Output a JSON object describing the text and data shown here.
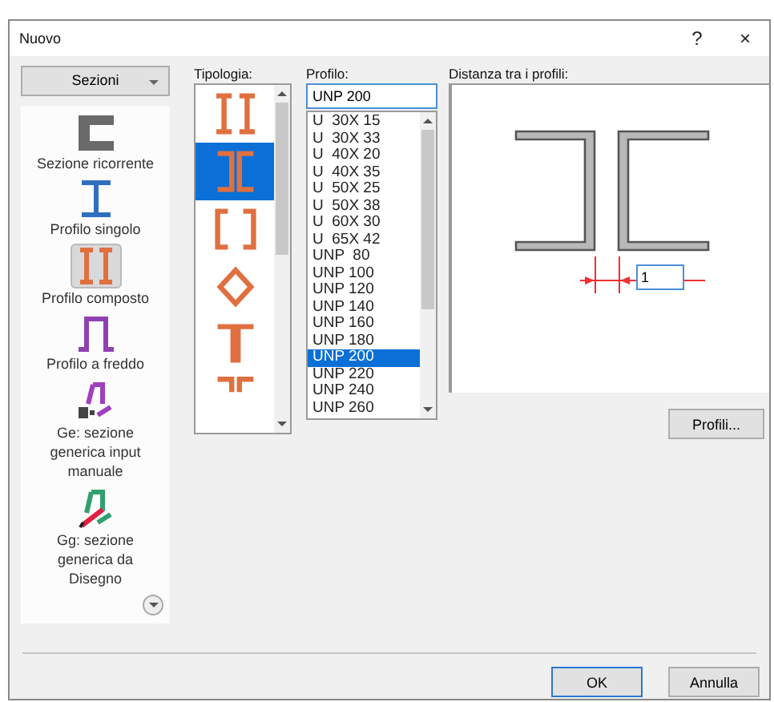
{
  "window": {
    "title": "Nuovo",
    "help": "?",
    "close": "×"
  },
  "section_menu": {
    "label": "Sezioni"
  },
  "section_types": [
    {
      "label": "Sezione ricorrente",
      "selected": false
    },
    {
      "label": "Profilo singolo",
      "selected": false
    },
    {
      "label": "Profilo composto",
      "selected": true
    },
    {
      "label": "Profilo a freddo",
      "selected": false
    },
    {
      "label": "Ge: sezione generica input manuale",
      "selected": false
    },
    {
      "label": "Gg: sezione generica da Disegno",
      "selected": false
    }
  ],
  "tipologia": {
    "label": "Tipologia:",
    "items": [
      {
        "selected": false
      },
      {
        "selected": true
      },
      {
        "selected": false
      },
      {
        "selected": false
      },
      {
        "selected": false
      },
      {
        "selected": false
      }
    ]
  },
  "profilo": {
    "label": "Profilo:",
    "value": "UNP 200",
    "items": [
      {
        "label": "U  30X 15",
        "selected": false
      },
      {
        "label": "U  30X 33",
        "selected": false
      },
      {
        "label": "U  40X 20",
        "selected": false
      },
      {
        "label": "U  40X 35",
        "selected": false
      },
      {
        "label": "U  50X 25",
        "selected": false
      },
      {
        "label": "U  50X 38",
        "selected": false
      },
      {
        "label": "U  60X 30",
        "selected": false
      },
      {
        "label": "U  65X 42",
        "selected": false
      },
      {
        "label": "UNP  80",
        "selected": false
      },
      {
        "label": "UNP 100",
        "selected": false
      },
      {
        "label": "UNP 120",
        "selected": false
      },
      {
        "label": "UNP 140",
        "selected": false
      },
      {
        "label": "UNP 160",
        "selected": false
      },
      {
        "label": "UNP 180",
        "selected": false
      },
      {
        "label": "UNP 200",
        "selected": true
      },
      {
        "label": "UNP 220",
        "selected": false
      },
      {
        "label": "UNP 240",
        "selected": false
      },
      {
        "label": "UNP 260",
        "selected": false
      }
    ]
  },
  "distanza": {
    "label": "Distanza tra i profili:",
    "value": "1"
  },
  "profili_button": "Profili...",
  "buttons": [
    {
      "label": "OK",
      "kind": "default"
    },
    {
      "label": "Annulla",
      "kind": "normal"
    }
  ]
}
